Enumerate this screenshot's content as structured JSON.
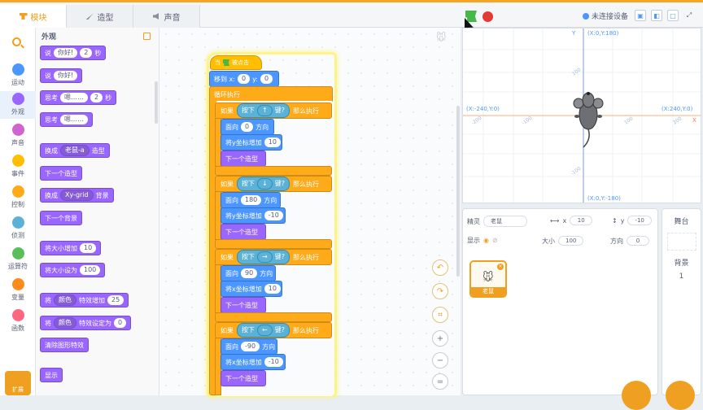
{
  "tabs": [
    {
      "label": "模块",
      "icon": "code-icon",
      "active": true
    },
    {
      "label": "造型",
      "icon": "brush-icon",
      "active": false
    },
    {
      "label": "声音",
      "icon": "speaker-icon",
      "active": false
    }
  ],
  "topbar": {
    "device_status": "未连接设备"
  },
  "categories": [
    {
      "label": "运动",
      "color": "#4c97ff"
    },
    {
      "label": "外观",
      "color": "#9966ff"
    },
    {
      "label": "声音",
      "color": "#cf63cf"
    },
    {
      "label": "事件",
      "color": "#ffbf00"
    },
    {
      "label": "控制",
      "color": "#ffab19"
    },
    {
      "label": "侦测",
      "color": "#5cb1d6"
    },
    {
      "label": "运算符",
      "color": "#59c059"
    },
    {
      "label": "变量",
      "color": "#ff8c1a"
    },
    {
      "label": "函数",
      "color": "#ff6680"
    }
  ],
  "extension_label": "扩展",
  "palette": {
    "title": "外观",
    "say_timed": {
      "text": "说",
      "msg": "你好!",
      "secs": "2",
      "unit": "秒"
    },
    "say": {
      "text": "说",
      "msg": "你好!"
    },
    "think_timed": {
      "text": "思考",
      "msg": "嗯……",
      "secs": "2",
      "unit": "秒"
    },
    "think": {
      "text": "思考",
      "msg": "嗯……"
    },
    "switch_costume": {
      "text": "换成",
      "value": "老鼠-a",
      "suffix": "造型"
    },
    "next_costume": "下一个造型",
    "switch_backdrop": {
      "text": "换成",
      "value": "Xy-grid",
      "suffix": "背景"
    },
    "next_backdrop": "下一个背景",
    "change_size": {
      "text": "将大小增加",
      "value": "10"
    },
    "set_size": {
      "text": "将大小设为",
      "value": "100"
    },
    "change_effect": {
      "text": "将",
      "effect": "颜色",
      "mid": "特效增加",
      "value": "25"
    },
    "set_effect": {
      "text": "将",
      "effect": "颜色",
      "mid": "特效设定为",
      "value": "0"
    },
    "clear_effects": "清除图形特效",
    "show": "显示"
  },
  "script": {
    "hat": {
      "prefix": "当",
      "suffix": "被点击"
    },
    "goto": {
      "text": "移到 x:",
      "x": "0",
      "ylabel": "y:",
      "y": "0"
    },
    "forever": "循环执行",
    "if_blocks": [
      {
        "if": "如果",
        "press": "按下",
        "key": "↑",
        "q": "键?",
        "then": "那么执行",
        "dir_label": "面向",
        "dir": "0",
        "dir_unit": "方向",
        "change_label": "将y坐标增加",
        "change": "10",
        "next": "下一个造型"
      },
      {
        "if": "如果",
        "press": "按下",
        "key": "↓",
        "q": "键?",
        "then": "那么执行",
        "dir_label": "面向",
        "dir": "180",
        "dir_unit": "方向",
        "change_label": "将y坐标增加",
        "change": "-10",
        "next": "下一个造型"
      },
      {
        "if": "如果",
        "press": "按下",
        "key": "→",
        "q": "键?",
        "then": "那么执行",
        "dir_label": "面向",
        "dir": "90",
        "dir_unit": "方向",
        "change_label": "将x坐标增加",
        "change": "10",
        "next": "下一个造型"
      },
      {
        "if": "如果",
        "press": "按下",
        "key": "←",
        "q": "键?",
        "then": "那么执行",
        "dir_label": "面向",
        "dir": "-90",
        "dir_unit": "方向",
        "change_label": "将x坐标增加",
        "change": "-10",
        "next": "下一个造型"
      }
    ]
  },
  "stage": {
    "y_axis": "Y",
    "x_axis": "X",
    "top_label": "(X:0,Y:180)",
    "bottom_label": "(X:0,Y:-180)",
    "left_label": "(X:-240,Y:0)",
    "right_label": "(X:240,Y:0)",
    "tick_100_y": "100",
    "tick_m100_y": "-100",
    "tick_m200_x": "-200",
    "tick_m100_x": "-100",
    "tick_100_x": "100",
    "tick_200_x": "200"
  },
  "sprite_panel": {
    "sprite_label": "精灵",
    "sprite_name": "老鼠",
    "x_label": "x",
    "x": "10",
    "y_label": "y",
    "y": "-10",
    "show_label": "显示",
    "size_label": "大小",
    "size": "100",
    "dir_label": "方向",
    "dir": "0",
    "sprite_thumb_name": "老鼠"
  },
  "stage_panel": {
    "title": "舞台",
    "backdrop_label": "背景",
    "backdrop_count": "1"
  }
}
